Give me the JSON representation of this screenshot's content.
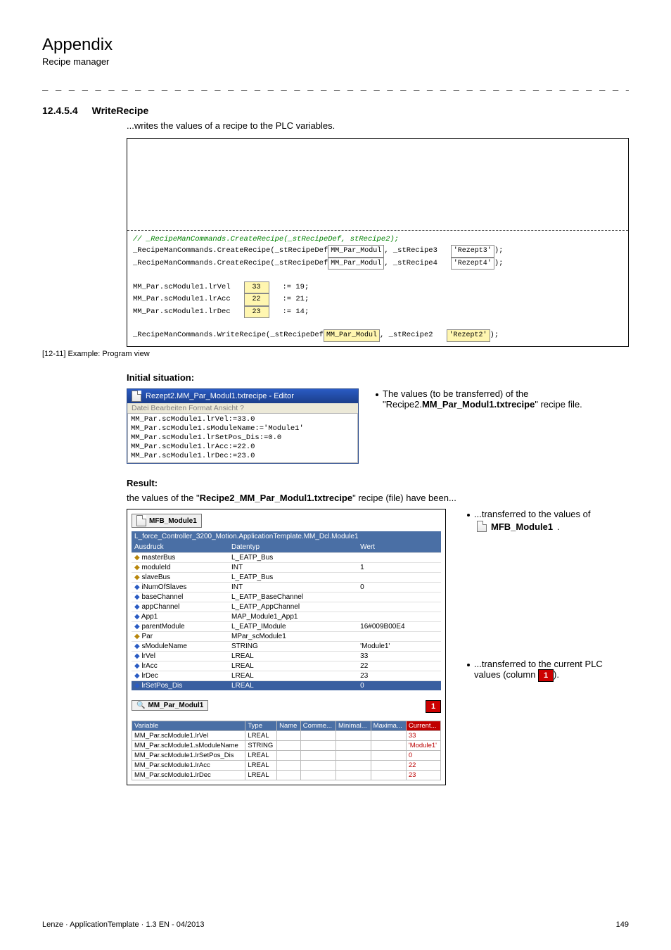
{
  "header": {
    "title": "Appendix",
    "subtitle": "Recipe manager"
  },
  "dashline": "_ _ _ _ _ _ _ _ _ _ _ _ _ _ _ _ _ _ _ _ _ _ _ _ _ _ _ _ _ _ _ _ _ _ _ _ _ _ _ _ _ _ _ _ _ _ _ _ _ _ _ _ _ _ _ _ _ _ _ _ _ _ _ _",
  "section": {
    "num": "12.4.5.4",
    "title": "WriteRecipe",
    "intro": "...writes the values of a recipe to the PLC variables."
  },
  "code": {
    "l1_comment": "// _RecipeManCommands.CreateRecipe(_stRecipeDef, stRecipe2);",
    "l2_pre": "_RecipeManCommands.CreateRecipe(_stRecipeDef",
    "pill_mm": "MM_Par_Modul",
    "l2_mid": ", _stRecipe3",
    "pill_r3": "'Rezept3'",
    "l2_end": ");",
    "l3_mid": ", _stRecipe4",
    "pill_r4": "'Rezept4'",
    "asg1_l": "MM_Par.scModule1.lrVel",
    "asg1_n": "33",
    "asg1_r": ":= 19;",
    "asg2_l": "MM_Par.scModule1.lrAcc",
    "asg2_n": "22",
    "asg2_r": ":= 21;",
    "asg3_l": "MM_Par.scModule1.lrDec",
    "asg3_n": "23",
    "asg3_r": ":= 14;",
    "w_pre": "_RecipeManCommands.WriteRecipe(_stRecipeDef",
    "pill_mm2": "MM_Par_Modul",
    "w_mid": ", _stRecipe2",
    "pill_r2": "'Rezept2'",
    "w_end": ");"
  },
  "caption": "[12-11]  Example: Program view",
  "initial": {
    "heading": "Initial situation:",
    "editor_title": "Rezept2.MM_Par_Modul1.txtrecipe - Editor",
    "editor_menu": "Datei  Bearbeiten  Format  Ansicht  ?",
    "editor_lines": "MM_Par.scModule1.lrVel:=33.0\nMM_Par.scModule1.sModuleName:='Module1'\nMM_Par.scModule1.lrSetPos_Dis:=0.0\nMM_Par.scModule1.lrAcc:=22.0\nMM_Par.scModule1.lrDec:=23.0",
    "right_bullet_pre": "The values (to be transferred) of the \"Recipe2.",
    "right_bullet_bold": "MM_Par_Modul1.txtrecipe",
    "right_bullet_post": "\" recipe file."
  },
  "result": {
    "heading": "Result:",
    "line_pre": "the values of the \"",
    "line_bold": "Recipe2_MM_Par_Modul1.txtrecipe",
    "line_post": "\" recipe (file) have been...",
    "right1": "...transferred to the values of",
    "mfb": "MFB_Module1",
    "dot": ".",
    "right2_pre": "...transferred to the current PLC values (column ",
    "right2_post": ")."
  },
  "tree": {
    "tab": "MFB_Module1",
    "path": "L_force_Controller_3200_Motion.ApplicationTemplate.MM_Dcl.Module1",
    "cols": [
      "Ausdruck",
      "Datentyp",
      "Wert"
    ],
    "rows": [
      {
        "ind": 0,
        "icon": "gold",
        "name": "masterBus",
        "type": "L_EATP_Bus",
        "val": ""
      },
      {
        "ind": 1,
        "icon": "gold",
        "name": "moduleId",
        "type": "INT",
        "val": "1"
      },
      {
        "ind": 0,
        "icon": "gold",
        "name": "slaveBus",
        "type": "L_EATP_Bus",
        "val": ""
      },
      {
        "ind": 1,
        "icon": "blue",
        "name": "iNumOfSlaves",
        "type": "INT",
        "val": "0"
      },
      {
        "ind": 0,
        "icon": "blue",
        "name": "baseChannel",
        "type": "L_EATP_BaseChannel",
        "val": ""
      },
      {
        "ind": 0,
        "icon": "blue",
        "name": "appChannel",
        "type": "L_EATP_AppChannel",
        "val": ""
      },
      {
        "ind": 0,
        "icon": "blue",
        "name": "App1",
        "type": "MAP_Module1_App1",
        "val": ""
      },
      {
        "ind": 1,
        "icon": "blue",
        "name": "parentModule",
        "type": "L_EATP_IModule",
        "val": "16#009B00E4"
      },
      {
        "ind": 1,
        "icon": "gold",
        "name": "Par",
        "type": "MPar_scModule1",
        "val": ""
      },
      {
        "ind": 2,
        "icon": "blue",
        "name": "sModuleName",
        "type": "STRING",
        "val": "'Module1'"
      },
      {
        "ind": 2,
        "icon": "blue",
        "name": "lrVel",
        "type": "LREAL",
        "val": "33"
      },
      {
        "ind": 2,
        "icon": "blue",
        "name": "lrAcc",
        "type": "LREAL",
        "val": "22"
      },
      {
        "ind": 2,
        "icon": "blue",
        "name": "lrDec",
        "type": "LREAL",
        "val": "23"
      },
      {
        "ind": 2,
        "icon": "blue",
        "name": "lrSetPos_Dis",
        "type": "LREAL",
        "val": "0",
        "sel": true
      }
    ]
  },
  "grid": {
    "tab": "MM_Par_Modul1",
    "cols": [
      "Variable",
      "Type",
      "Name",
      "Comme...",
      "Minimal...",
      "Maxima...",
      "Current..."
    ],
    "rows": [
      [
        "MM_Par.scModule1.lrVel",
        "LREAL",
        "",
        "",
        "",
        "",
        "33"
      ],
      [
        "MM_Par.scModule1.sModuleName",
        "STRING",
        "",
        "",
        "",
        "",
        "'Module1'"
      ],
      [
        "MM_Par.scModule1.lrSetPos_Dis",
        "LREAL",
        "",
        "",
        "",
        "",
        "0"
      ],
      [
        "MM_Par.scModule1.lrAcc",
        "LREAL",
        "",
        "",
        "",
        "",
        "22"
      ],
      [
        "MM_Par.scModule1.lrDec",
        "LREAL",
        "",
        "",
        "",
        "",
        "23"
      ]
    ],
    "marker": "1"
  },
  "footer": {
    "left": "Lenze · ApplicationTemplate · 1.3 EN - 04/2013",
    "right": "149"
  }
}
